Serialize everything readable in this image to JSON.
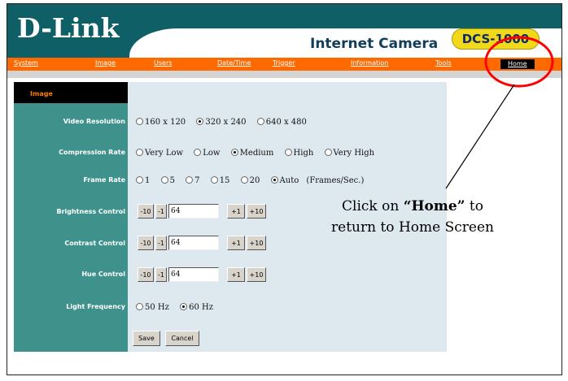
{
  "header": {
    "logo": "D-Link",
    "product": "Internet Camera",
    "model": "DCS-1000"
  },
  "nav": {
    "items": [
      {
        "label": "System"
      },
      {
        "label": "Image"
      },
      {
        "label": "Users"
      },
      {
        "label": "Date/Time"
      },
      {
        "label": "Trigger"
      },
      {
        "label": "Information"
      },
      {
        "label": "Tools"
      },
      {
        "label": "Home",
        "active": true
      }
    ]
  },
  "section": {
    "title": "Image"
  },
  "settings": {
    "video_resolution": {
      "label": "Video Resolution",
      "options": [
        "160 x 120",
        "320 x 240",
        "640 x 480"
      ],
      "selected": "320 x 240"
    },
    "compression_rate": {
      "label": "Compression Rate",
      "options": [
        "Very Low",
        "Low",
        "Medium",
        "High",
        "Very High"
      ],
      "selected": "Medium"
    },
    "frame_rate": {
      "label": "Frame Rate",
      "options": [
        "1",
        "5",
        "7",
        "15",
        "20",
        "Auto"
      ],
      "selected": "Auto",
      "unit": "(Frames/Sec.)"
    },
    "brightness": {
      "label": "Brightness Control",
      "value": "64"
    },
    "contrast": {
      "label": "Contrast Control",
      "value": "64"
    },
    "hue": {
      "label": "Hue Control",
      "value": "64"
    },
    "light_frequency": {
      "label": "Light Frequency",
      "options": [
        "50 Hz",
        "60 Hz"
      ],
      "selected": "60 Hz"
    },
    "step_buttons": {
      "minus10": "-10",
      "minus1": "-1",
      "plus1": "+1",
      "plus10": "+10"
    }
  },
  "actions": {
    "save": "Save",
    "cancel": "Cancel"
  },
  "annotation": {
    "prefix": "Click on ",
    "emphasis": "“Home”",
    "suffix": " to",
    "line2": "return to Home Screen"
  },
  "colors": {
    "header_bg": "#0e5f66",
    "nav_bg": "#ff6a00",
    "sidebar_bg": "#3f928b",
    "panel_bg": "#dde8ef",
    "badge_bg": "#f0d81a",
    "highlight_circle": "#ff0000"
  },
  "icons": {
    "radio": "radio-button",
    "highlight": "red-circle-highlight",
    "pointer": "pointer-line"
  }
}
